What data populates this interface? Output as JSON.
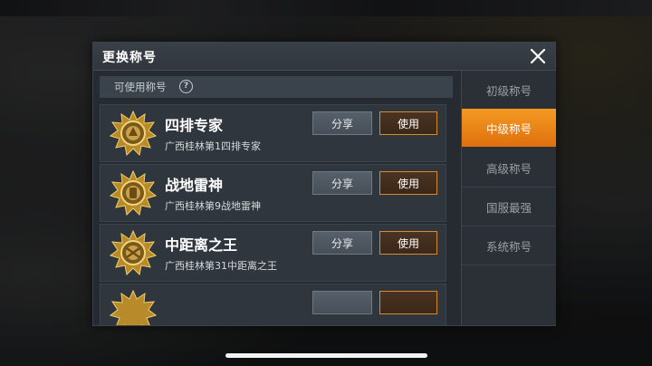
{
  "dialog": {
    "title": "更换称号"
  },
  "available": {
    "label": "可使用称号",
    "help_glyph": "?"
  },
  "titles": [
    {
      "name": "四排专家",
      "desc": "广西桂林第1四排专家",
      "share_label": "分享",
      "use_label": "使用"
    },
    {
      "name": "战地雷神",
      "desc": "广西桂林第9战地雷神",
      "share_label": "分享",
      "use_label": "使用"
    },
    {
      "name": "中距离之王",
      "desc": "广西桂林第31中距离之王",
      "share_label": "分享",
      "use_label": "使用"
    }
  ],
  "tabs": [
    {
      "label": "初级称号",
      "active": false
    },
    {
      "label": "中级称号",
      "active": true
    },
    {
      "label": "高级称号",
      "active": false
    },
    {
      "label": "国服最强",
      "active": false
    },
    {
      "label": "系统称号",
      "active": false
    }
  ],
  "colors": {
    "accent": "#f08a1c",
    "badge_gold": "#d9a63a"
  },
  "icons": [
    "close-icon",
    "help-icon",
    "gold-star-badge-icon"
  ]
}
